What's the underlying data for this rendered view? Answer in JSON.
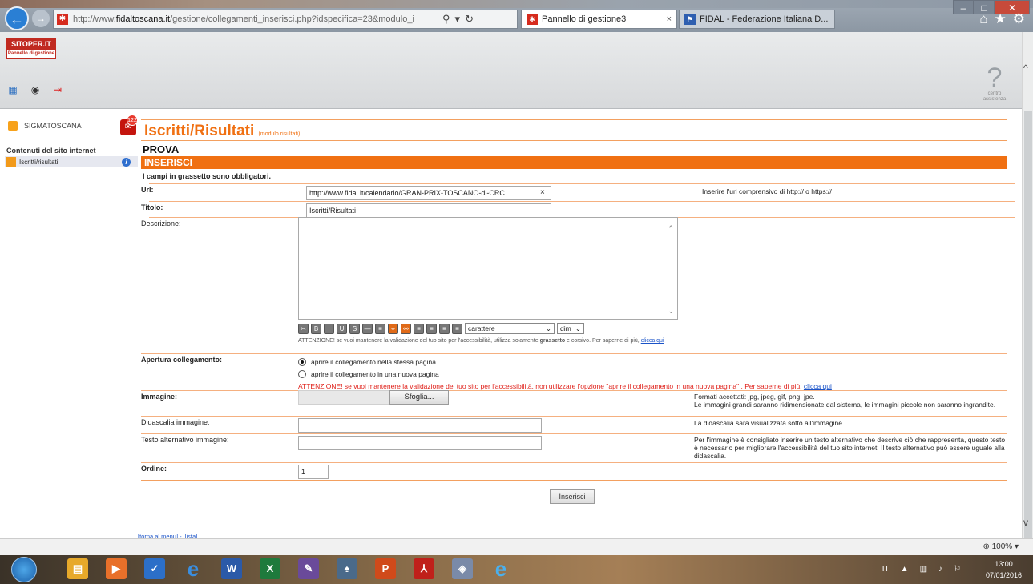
{
  "browser": {
    "url_prefix": "http://www.",
    "url_domain": "fidaltoscana.it",
    "url_rest": "/gestione/collegamenti_inserisci.php?idspecifica=23&modulo_i",
    "tabs": [
      {
        "label": "Pannello di gestione3",
        "close": "×"
      },
      {
        "label": "FIDAL - Federazione Italiana D..."
      }
    ]
  },
  "header": {
    "logo_top": "SITOPER.IT",
    "logo_sub": "Pannello di gestione",
    "help_label": "centro assistenza"
  },
  "sidebar": {
    "site_name": "SIGMATOSCANA",
    "notif_count": "122",
    "heading": "Contenuti del sito internet",
    "item": "Iscritti/risultati"
  },
  "main": {
    "title": "Iscritti/Risultati",
    "title_module": "(modulo risultati)",
    "subtitle": "PROVA",
    "section": "INSERISCI",
    "required_note": "I campi in grassetto sono obbligatori.",
    "fields": {
      "url_label": "Url:",
      "url_value": "http://www.fidal.it/calendario/GRAN-PRIX-TOSCANO-di-CRC",
      "url_clear": "×",
      "url_hint": "Inserire l'url comprensivo di http:// o https://",
      "title_label": "Titolo:",
      "title_value": "Iscritti/Risultati",
      "desc_label": "Descrizione:",
      "font_select": "carattere",
      "size_select": "dim",
      "editor_warn": "ATTENZIONE! se vuoi mantenere la validazione del tuo sito per l'accessibilità, utilizza solamente",
      "editor_warn_bold": "grassetto",
      "editor_warn_mid": "e",
      "editor_warn_it": "corsivo",
      "editor_warn_end": ". Per saperne di più,",
      "editor_warn_link": "clicca qui",
      "open_label": "Apertura collegamento:",
      "open_same": "aprire il collegamento nella stessa pagina",
      "open_new": "aprire il collegamento in una nuova pagina",
      "open_warn": "ATTENZIONE! se vuoi mantenere la validazione del tuo sito per l'accessibilità, non utilizzare l'opzione \"aprire il collegamento in una nuova pagina\" . Per saperne di più,",
      "open_warn_link": "clicca qui",
      "image_label": "Immagine:",
      "browse": "Sfoglia...",
      "image_hint": "Formati accettati: jpg, jpeg, gif, png, jpe.",
      "image_hint2": "Le immagini grandi saranno ridimensionate dal sistema, le immagini piccole non saranno ingrandite.",
      "caption_label": "Didascalia immagine:",
      "caption_value": "",
      "caption_hint": "La didascalia sarà visualizzata sotto all'immagine.",
      "alt_label": "Testo alternativo immagine:",
      "alt_value": "",
      "alt_hint": "Per l'immagine è consigliato inserire un testo alternativo che descrive ciò che rappresenta, questo testo è necessario per migliorare l'accessibilità del tuo sito internet. Il testo alternativo può essere uguale alla didascalia.",
      "order_label": "Ordine:",
      "order_value": "1"
    },
    "submit": "Inserisci",
    "footer_back": "[torna al menu]",
    "footer_sep": " - ",
    "footer_list": "[lista]"
  },
  "status": {
    "zoom": "100%"
  },
  "taskbar": {
    "lang": "IT",
    "time": "13:00",
    "date": "07/01/2016"
  }
}
